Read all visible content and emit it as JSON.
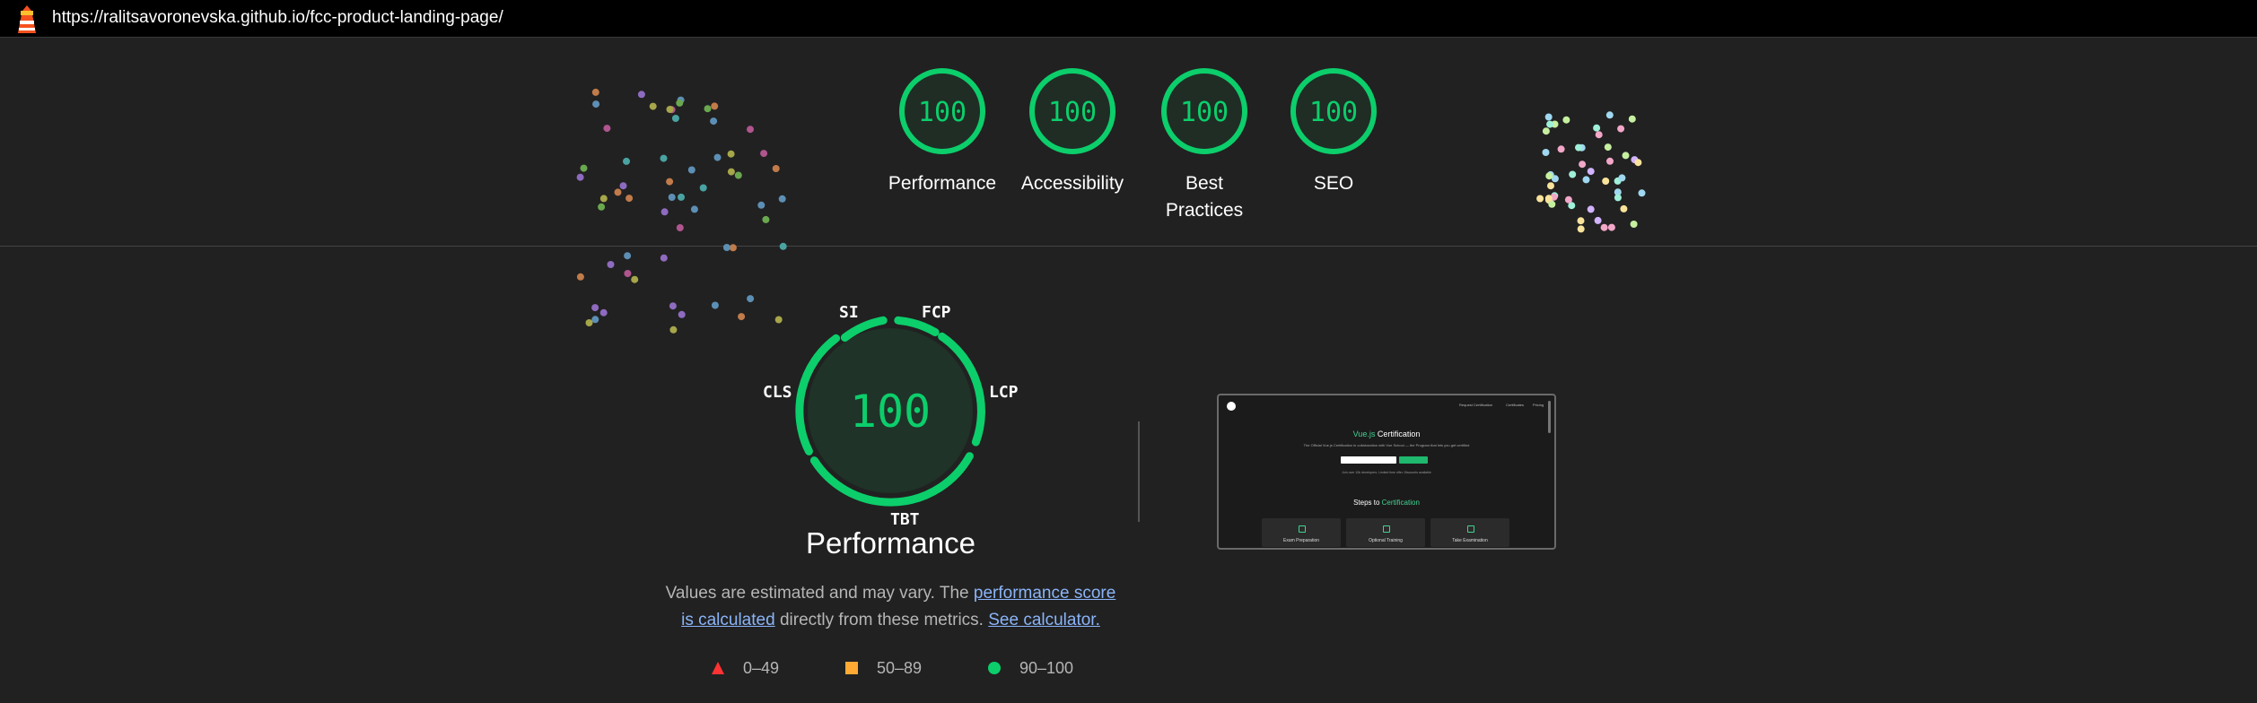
{
  "browser": {
    "url": "https://ralitsavoronevska.github.io/fcc-product-landing-page/"
  },
  "summary_scores": [
    {
      "value": "100",
      "label": "Performance"
    },
    {
      "value": "100",
      "label": "Accessibility"
    },
    {
      "value": "100",
      "label": "Best Practices"
    },
    {
      "value": "100",
      "label": "SEO"
    }
  ],
  "performance": {
    "score": "100",
    "title": "Performance",
    "metrics": [
      "SI",
      "FCP",
      "LCP",
      "TBT",
      "CLS"
    ],
    "description_prefix": "Values are estimated and may vary. The ",
    "description_link": "performance score is calculated",
    "description_suffix": " directly from these metrics. ",
    "calculator_link": "See calculator."
  },
  "legend": [
    {
      "shape": "triangle",
      "range": "0–49",
      "color": "#ff3333"
    },
    {
      "shape": "square",
      "range": "50–89",
      "color": "#ffaa33"
    },
    {
      "shape": "circle",
      "range": "90–100",
      "color": "#0cce6b"
    }
  ],
  "colors": {
    "pass": "#0cce6b",
    "background": "#212121",
    "link": "#8ab4f8"
  },
  "screenshot_thumbnail": {
    "nav_items": [
      "Request Certification",
      "Certificates",
      "Pricing"
    ],
    "title_accent": "Vue.js",
    "title_rest": " Certification",
    "subtitle": "The Official Vue.js Certification in collaboration with Vue School — the Program that lets you get certified",
    "button": "Get Certified",
    "note": "Join over 10k developers. Limited time offer. Discounts available",
    "steps_prefix": "Steps to ",
    "steps_accent": "Certification",
    "cards": [
      "Exam Preparation",
      "Optional Training",
      "Take Examination"
    ]
  }
}
